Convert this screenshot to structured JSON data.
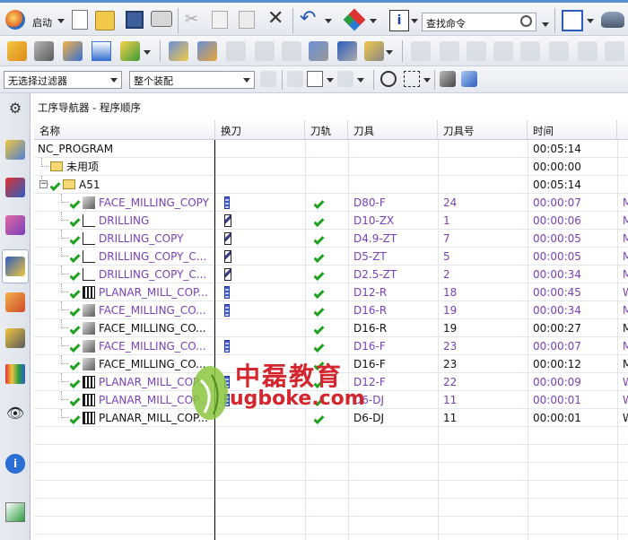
{
  "toolbar1": {
    "start_label": "启动",
    "search_placeholder": "查找命令"
  },
  "toolbar3": {
    "filter_value": "无选择过滤器",
    "scope_value": "整个装配"
  },
  "navigator": {
    "title": "工序导航器 - 程序顺序",
    "columns": [
      "名称",
      "换刀",
      "刀轨",
      "刀具",
      "刀具号",
      "时间"
    ],
    "rows": [
      {
        "name": "NC_PROGRAM",
        "tool": "",
        "num": "",
        "time": "00:05:14",
        "extra": "",
        "purple": false,
        "level": 0,
        "icon": "none",
        "check": false,
        "toolicon": "none",
        "path": false
      },
      {
        "name": "未用项",
        "tool": "",
        "num": "",
        "time": "00:00:00",
        "extra": "",
        "purple": false,
        "level": 1,
        "icon": "folder",
        "check": false,
        "toolicon": "none",
        "path": false
      },
      {
        "name": "A51",
        "tool": "",
        "num": "",
        "time": "00:05:14",
        "extra": "",
        "purple": false,
        "level": 1,
        "icon": "folder",
        "check": true,
        "toolicon": "none",
        "path": false,
        "expand": true
      },
      {
        "name": "FACE_MILLING_COPY",
        "tool": "D80-F",
        "num": "24",
        "time": "00:00:07",
        "extra": "M",
        "purple": true,
        "level": 2,
        "icon": "face",
        "check": true,
        "toolicon": "mill",
        "path": true
      },
      {
        "name": "DRILLING",
        "tool": "D10-ZX",
        "num": "1",
        "time": "00:00:06",
        "extra": "M",
        "purple": true,
        "level": 2,
        "icon": "drill",
        "check": true,
        "toolicon": "drill",
        "path": true
      },
      {
        "name": "DRILLING_COPY",
        "tool": "D4.9-ZT",
        "num": "7",
        "time": "00:00:05",
        "extra": "M",
        "purple": true,
        "level": 2,
        "icon": "drill",
        "check": true,
        "toolicon": "drill",
        "path": true
      },
      {
        "name": "DRILLING_COPY_C...",
        "tool": "D5-ZT",
        "num": "5",
        "time": "00:00:05",
        "extra": "M",
        "purple": true,
        "level": 2,
        "icon": "drill",
        "check": true,
        "toolicon": "drill",
        "path": true
      },
      {
        "name": "DRILLING_COPY_C...",
        "tool": "D2.5-ZT",
        "num": "2",
        "time": "00:00:34",
        "extra": "M",
        "purple": true,
        "level": 2,
        "icon": "drill",
        "check": true,
        "toolicon": "drill",
        "path": true
      },
      {
        "name": "PLANAR_MILL_COP...",
        "tool": "D12-R",
        "num": "18",
        "time": "00:00:45",
        "extra": "W",
        "purple": true,
        "level": 2,
        "icon": "planar",
        "check": true,
        "toolicon": "mill",
        "path": true
      },
      {
        "name": "FACE_MILLING_CO...",
        "tool": "D16-R",
        "num": "19",
        "time": "00:00:34",
        "extra": "M",
        "purple": true,
        "level": 2,
        "icon": "face",
        "check": true,
        "toolicon": "mill",
        "path": true
      },
      {
        "name": "FACE_MILLING_CO...",
        "tool": "D16-R",
        "num": "19",
        "time": "00:00:27",
        "extra": "M",
        "purple": false,
        "level": 2,
        "icon": "face",
        "check": true,
        "toolicon": "none",
        "path": true
      },
      {
        "name": "FACE_MILLING_CO...",
        "tool": "D16-F",
        "num": "23",
        "time": "00:00:07",
        "extra": "M",
        "purple": true,
        "level": 2,
        "icon": "face",
        "check": true,
        "toolicon": "mill",
        "path": true
      },
      {
        "name": "FACE_MILLING_CO...",
        "tool": "D16-F",
        "num": "23",
        "time": "00:00:12",
        "extra": "M",
        "purple": false,
        "level": 2,
        "icon": "face",
        "check": true,
        "toolicon": "none",
        "path": true
      },
      {
        "name": "PLANAR_MILL_COP...",
        "tool": "D12-F",
        "num": "22",
        "time": "00:00:09",
        "extra": "W",
        "purple": true,
        "level": 2,
        "icon": "planar",
        "check": true,
        "toolicon": "mill",
        "path": true
      },
      {
        "name": "PLANAR_MILL_COP...",
        "tool": "D6-DJ",
        "num": "11",
        "time": "00:00:01",
        "extra": "W",
        "purple": true,
        "level": 2,
        "icon": "planar",
        "check": true,
        "toolicon": "mill",
        "path": true
      },
      {
        "name": "PLANAR_MILL_COP...",
        "tool": "D6-DJ",
        "num": "11",
        "time": "00:00:01",
        "extra": "W",
        "purple": false,
        "level": 2,
        "icon": "planar",
        "check": true,
        "toolicon": "none",
        "path": true
      }
    ]
  },
  "watermark": {
    "text": "中磊教育",
    "url": "ugboke.com"
  },
  "colors": {
    "accent": "#5a8fd0",
    "check_green": "#1ea31e",
    "modified_purple": "#7a3fb8",
    "watermark_red": "#d4262e"
  }
}
